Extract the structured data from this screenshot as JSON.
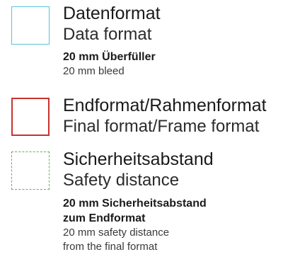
{
  "legend": {
    "items": [
      {
        "title_de": "Datenformat",
        "title_en": "Data format",
        "note_de": [
          "20 mm Überfüller"
        ],
        "note_en": [
          "20 mm bleed"
        ],
        "swatch_color": "#5bc3d8",
        "swatch_style": "solid"
      },
      {
        "title_de": "Endformat/Rahmenformat",
        "title_en": "Final format/Frame format",
        "swatch_color": "#c8322d",
        "swatch_style": "solid"
      },
      {
        "title_de": "Sicherheitsabstand",
        "title_en": "Safety distance",
        "note_de": [
          "20 mm Sicherheitsabstand",
          "zum Endformat"
        ],
        "note_en": [
          "20 mm safety distance",
          "from the final format"
        ],
        "swatch_color": "#5cb848",
        "swatch_style": "dashed"
      }
    ]
  }
}
